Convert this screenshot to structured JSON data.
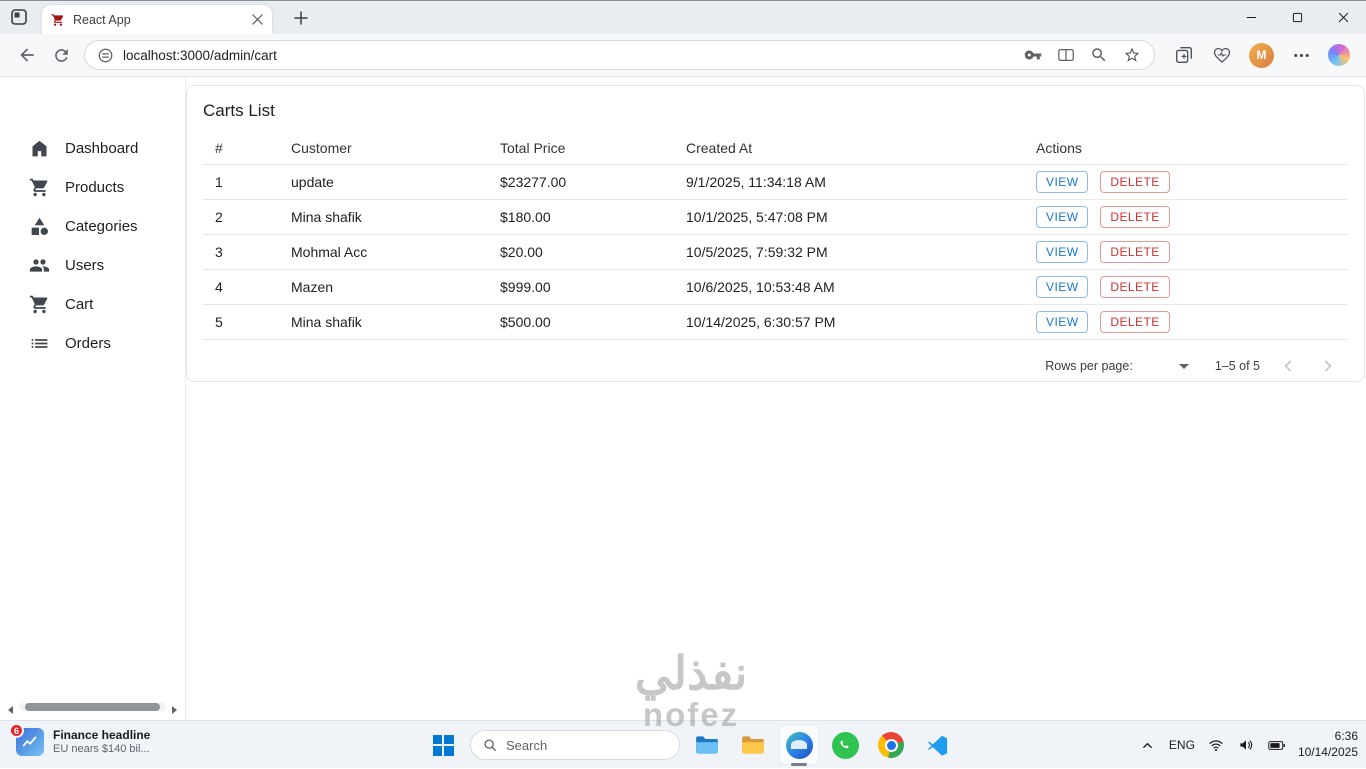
{
  "browser": {
    "tab_title": "React App",
    "url": "localhost:3000/admin/cart",
    "profile_initial": "M"
  },
  "sidebar": {
    "items": [
      {
        "label": "Dashboard"
      },
      {
        "label": "Products"
      },
      {
        "label": "Categories"
      },
      {
        "label": "Users"
      },
      {
        "label": "Cart"
      },
      {
        "label": "Orders"
      }
    ]
  },
  "main": {
    "title": "Carts List",
    "table": {
      "headers": [
        "#",
        "Customer",
        "Total Price",
        "Created At",
        "Actions"
      ],
      "rows": [
        {
          "num": "1",
          "customer": "update",
          "total": "$23277.00",
          "created": "9/1/2025, 11:34:18 AM"
        },
        {
          "num": "2",
          "customer": "Mina shafik",
          "total": "$180.00",
          "created": "10/1/2025, 5:47:08 PM"
        },
        {
          "num": "3",
          "customer": "Mohmal Acc",
          "total": "$20.00",
          "created": "10/5/2025, 7:59:32 PM"
        },
        {
          "num": "4",
          "customer": "Mazen",
          "total": "$999.00",
          "created": "10/6/2025, 10:53:48 AM"
        },
        {
          "num": "5",
          "customer": "Mina shafik",
          "total": "$500.00",
          "created": "10/14/2025, 6:30:57 PM"
        }
      ],
      "view_label": "VIEW",
      "delete_label": "DELETE"
    },
    "pagination": {
      "rows_per_page_label": "Rows per page:",
      "range": "1–5 of 5"
    }
  },
  "taskbar": {
    "widget": {
      "badge": "6",
      "title": "Finance headline",
      "subtitle": "EU nears $140 bil..."
    },
    "search_placeholder": "Search",
    "tray": {
      "lang": "ENG",
      "time": "6:36",
      "date": "10/14/2025"
    }
  },
  "watermark": {
    "line1": "نفذلي",
    "line2": "nofez"
  },
  "colors": {
    "view_button": "#1976d2",
    "delete_button": "#d32f2f",
    "windows_accent": "#0078d4",
    "badge_red": "#e3242b"
  }
}
